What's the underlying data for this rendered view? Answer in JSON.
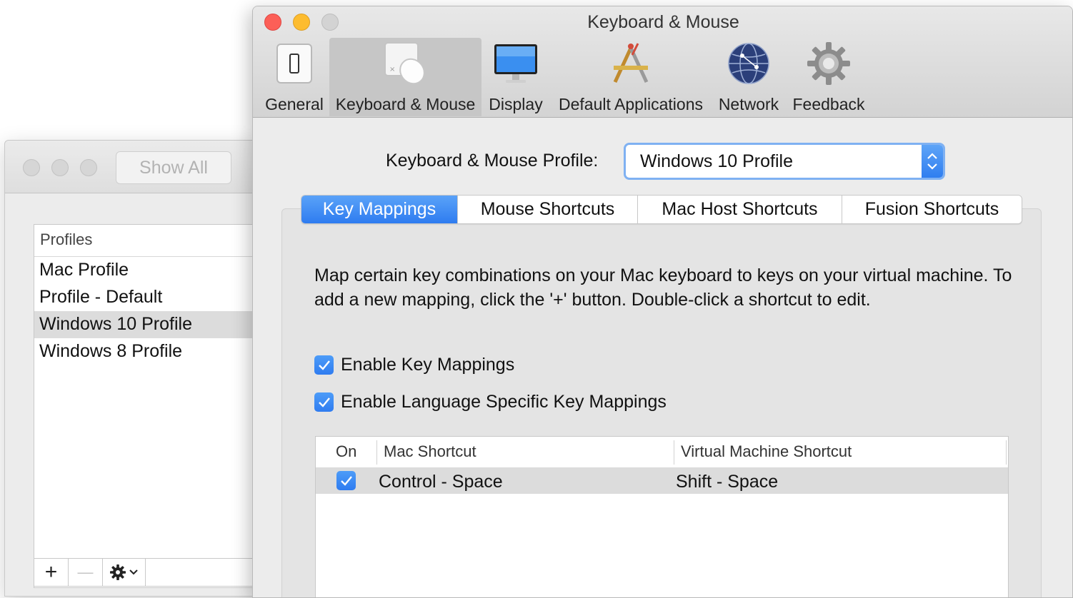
{
  "back_window": {
    "show_all_label": "Show All",
    "profiles_header": "Profiles",
    "profiles": [
      {
        "name": "Mac Profile",
        "selected": false
      },
      {
        "name": "Profile - Default",
        "selected": false
      },
      {
        "name": "Windows 10 Profile",
        "selected": true
      },
      {
        "name": "Windows 8 Profile",
        "selected": false
      }
    ],
    "toolbar": {
      "add_label": "+",
      "remove_label": "—",
      "gear_icon": "gear-icon",
      "gear_chevron": "⌄"
    }
  },
  "front_window": {
    "title": "Keyboard & Mouse",
    "pref_tabs": [
      {
        "label": "General",
        "icon": "general-switch-icon",
        "selected": false
      },
      {
        "label": "Keyboard & Mouse",
        "icon": "keyboard-mouse-icon",
        "selected": true
      },
      {
        "label": "Display",
        "icon": "display-monitor-icon",
        "selected": false
      },
      {
        "label": "Default Applications",
        "icon": "default-applications-icon",
        "selected": false
      },
      {
        "label": "Network",
        "icon": "network-globe-icon",
        "selected": false
      },
      {
        "label": "Feedback",
        "icon": "feedback-gear-icon",
        "selected": false
      }
    ],
    "profile_label": "Keyboard & Mouse Profile:",
    "profile_selected": "Windows 10 Profile",
    "segments": [
      {
        "label": "Key Mappings",
        "active": true
      },
      {
        "label": "Mouse Shortcuts",
        "active": false
      },
      {
        "label": "Mac Host Shortcuts",
        "active": false
      },
      {
        "label": "Fusion Shortcuts",
        "active": false
      }
    ],
    "description": "Map certain key combinations on your Mac keyboard to keys on your virtual machine. To add a new mapping, click the '+' button. Double-click a shortcut to edit.",
    "checkboxes": [
      {
        "label": "Enable Key Mappings",
        "checked": true
      },
      {
        "label": "Enable Language Specific Key Mappings",
        "checked": true
      }
    ],
    "table": {
      "columns": [
        "On",
        "Mac Shortcut",
        "Virtual Machine Shortcut"
      ],
      "rows": [
        {
          "on": true,
          "mac_shortcut": "Control - Space",
          "vm_shortcut": "Shift - Space"
        }
      ]
    }
  },
  "colors": {
    "accent_blue": "#2f7cf0",
    "close_red": "#fc5f57",
    "minimize_yellow": "#fdbc2f",
    "zoom_gray": "#d3d3d3"
  }
}
